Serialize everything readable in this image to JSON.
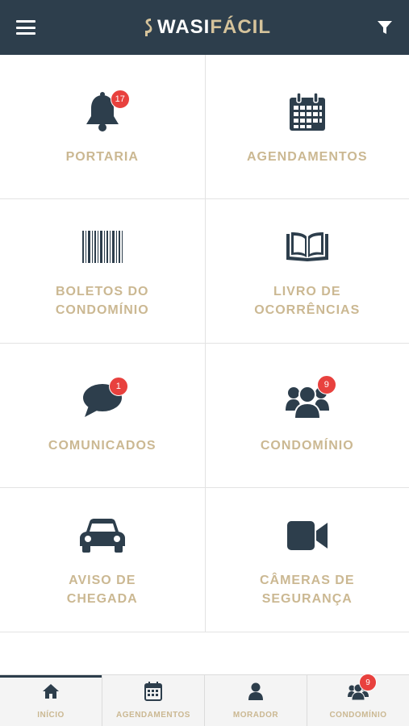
{
  "header": {
    "logo_part1": "WASI",
    "logo_part2": "FÁCIL",
    "menu_icon": "hamburger-menu-icon",
    "filter_icon": "filter-funnel-icon"
  },
  "colors": {
    "header_bg": "#2d3e4c",
    "icon": "#2d3e4c",
    "label": "#cbb892",
    "badge": "#e8413e",
    "brand_gold": "#d5c39b"
  },
  "menu": [
    {
      "label_lines": [
        "PORTARIA"
      ],
      "icon": "bell-icon",
      "badge": "17"
    },
    {
      "label_lines": [
        "AGENDAMENTOS"
      ],
      "icon": "calendar-icon",
      "badge": null
    },
    {
      "label_lines": [
        "BOLETOS DO",
        "CONDOMÍNIO"
      ],
      "icon": "barcode-icon",
      "badge": null
    },
    {
      "label_lines": [
        "LIVRO DE",
        "OCORRÊNCIAS"
      ],
      "icon": "open-book-icon",
      "badge": null
    },
    {
      "label_lines": [
        "COMUNICADOS"
      ],
      "icon": "chat-bubble-icon",
      "badge": "1"
    },
    {
      "label_lines": [
        "CONDOMÍNIO"
      ],
      "icon": "people-group-icon",
      "badge": "9"
    },
    {
      "label_lines": [
        "AVISO DE",
        "CHEGADA"
      ],
      "icon": "car-icon",
      "badge": null
    },
    {
      "label_lines": [
        "CÂMERAS DE",
        "SEGURANÇA"
      ],
      "icon": "video-camera-icon",
      "badge": null
    }
  ],
  "tabs": [
    {
      "label": "INÍCIO",
      "icon": "home-icon",
      "active": true,
      "badge": null
    },
    {
      "label": "AGENDAMENTOS",
      "icon": "calendar-icon",
      "active": false,
      "badge": null
    },
    {
      "label": "MORADOR",
      "icon": "person-icon",
      "active": false,
      "badge": null
    },
    {
      "label": "CONDOMÍNIO",
      "icon": "people-group-icon",
      "active": false,
      "badge": "9"
    }
  ]
}
